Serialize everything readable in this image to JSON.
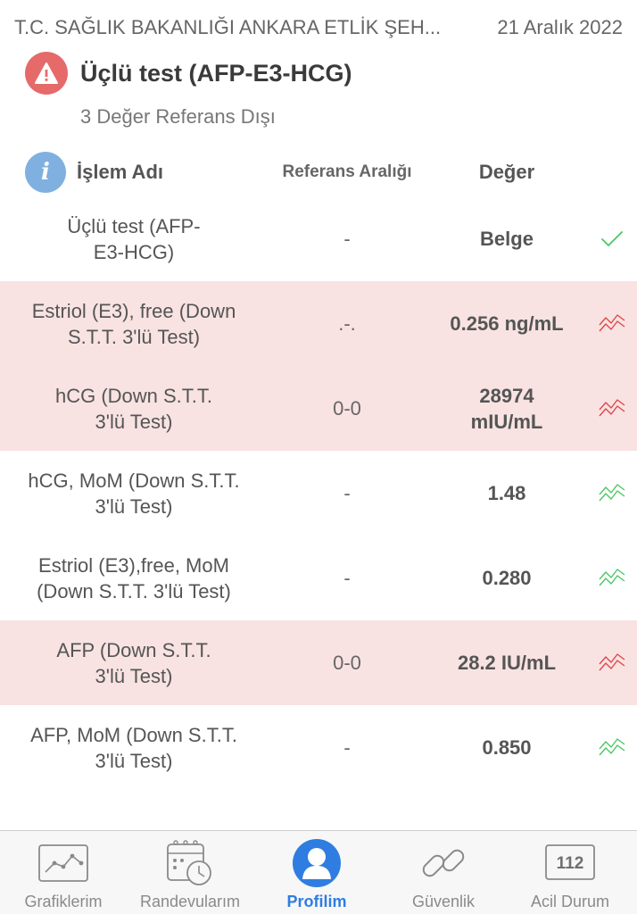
{
  "header": {
    "institution": "T.C. SAĞLIK BAKANLIĞI ANKARA ETLİK ŞEH...",
    "date": "21 Aralık 2022"
  },
  "test": {
    "title": "Üçlü test (AFP-E3-HCG)",
    "subtitle": "3 Değer Referans Dışı",
    "warning_icon": "warning-icon"
  },
  "columns": {
    "name": "İşlem Adı",
    "reference": "Referans Aralığı",
    "value": "Değer",
    "info_icon": "info-icon",
    "info_glyph": "i"
  },
  "colors": {
    "out_of_range_bg": "#f8e3e2",
    "alert_red": "#e0474c",
    "ok_green": "#4cc764",
    "accent_blue": "#2f7de0"
  },
  "results": [
    {
      "name_line1": "Üçlü test (AFP-",
      "name_line2": "E3-HCG)",
      "reference": "-",
      "value_line1": "Belge",
      "value_line2": "",
      "status": "ok",
      "icon": "checkmark-icon"
    },
    {
      "name_line1": "Estriol (E3), free (Down",
      "name_line2": "S.T.T. 3'lü Test)",
      "reference": ".-.",
      "value_line1": "0.256 ng/mL",
      "value_line2": "",
      "status": "out",
      "icon": "trend-chart-icon"
    },
    {
      "name_line1": "hCG (Down S.T.T.",
      "name_line2": "3'lü Test)",
      "reference": "0-0",
      "value_line1": "28974",
      "value_line2": "mIU/mL",
      "status": "out",
      "icon": "trend-chart-icon"
    },
    {
      "name_line1": "hCG, MoM (Down S.T.T.",
      "name_line2": "3'lü Test)",
      "reference": "-",
      "value_line1": "1.48",
      "value_line2": "",
      "status": "normal",
      "icon": "trend-chart-icon"
    },
    {
      "name_line1": "Estriol (E3),free, MoM",
      "name_line2": "(Down S.T.T. 3'lü Test)",
      "reference": "-",
      "value_line1": "0.280",
      "value_line2": "",
      "status": "normal",
      "icon": "trend-chart-icon"
    },
    {
      "name_line1": "AFP (Down S.T.T.",
      "name_line2": "3'lü Test)",
      "reference": "0-0",
      "value_line1": "28.2 IU/mL",
      "value_line2": "",
      "status": "out",
      "icon": "trend-chart-icon"
    },
    {
      "name_line1": "AFP, MoM (Down S.T.T.",
      "name_line2": "3'lü Test)",
      "reference": "-",
      "value_line1": "0.850",
      "value_line2": "",
      "status": "normal",
      "icon": "trend-chart-icon"
    }
  ],
  "tabbar": {
    "active": "profilim",
    "tabs": [
      {
        "label": "Grafiklerim",
        "icon": "line-chart-icon"
      },
      {
        "label": "Randevularım",
        "icon": "calendar-clock-icon"
      },
      {
        "label": "Profilim",
        "icon": "profile-icon"
      },
      {
        "label": "Güvenlik",
        "icon": "link-icon"
      },
      {
        "label": "Acil Durum",
        "icon": "emergency-112-icon",
        "icon_text": "112"
      }
    ]
  }
}
